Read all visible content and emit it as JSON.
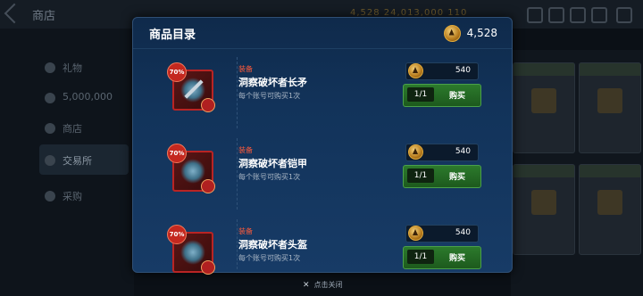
{
  "background": {
    "title": "商店",
    "stats_text": "4,528  24,013,000  110",
    "side_items": [
      "礼物",
      "5,000,000",
      "商店",
      "交易所",
      "采购"
    ]
  },
  "modal": {
    "title": "商品目录",
    "currency_icon": "gold-coin-icon",
    "currency_value": "4,528"
  },
  "items": [
    {
      "category": "装备",
      "name": "洞察破坏者长矛",
      "limit": "每个账号可购买1次",
      "price": "540",
      "qty": "1/1",
      "buy_label": "购买",
      "discount": "70%"
    },
    {
      "category": "装备",
      "name": "洞察破坏者铠甲",
      "limit": "每个账号可购买1次",
      "price": "540",
      "qty": "1/1",
      "buy_label": "购买",
      "discount": "70%"
    },
    {
      "category": "装备",
      "name": "洞察破坏者头盔",
      "limit": "每个账号可购买1次",
      "price": "540",
      "qty": "1/1",
      "buy_label": "购买",
      "discount": "70%"
    }
  ],
  "close_hint": "点击关闭",
  "colors": {
    "accent": "#b92424",
    "buy_green": "#2c7a2c",
    "category_red": "#ff5a3a"
  }
}
